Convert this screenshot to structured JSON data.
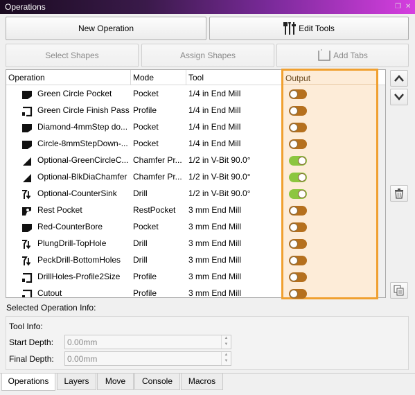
{
  "window": {
    "title": "Operations"
  },
  "toolbar": {
    "new_operation": "New Operation",
    "edit_tools": "Edit Tools",
    "select_shapes": "Select Shapes",
    "assign_shapes": "Assign Shapes",
    "add_tabs": "Add Tabs"
  },
  "table": {
    "headers": {
      "operation": "Operation",
      "mode": "Mode",
      "tool": "Tool",
      "output": "Output"
    },
    "rows": [
      {
        "name": "Green Circle Pocket",
        "mode": "Pocket",
        "tool": "1/4 in End Mill",
        "icon": "pocket-icon",
        "output": false
      },
      {
        "name": "Green Circle Finish Pass",
        "mode": "Profile",
        "tool": "1/4 in End Mill",
        "icon": "profile-icon",
        "output": false
      },
      {
        "name": "Diamond-4mmStep do...",
        "mode": "Pocket",
        "tool": "1/4 in End Mill",
        "icon": "pocket-icon",
        "output": false
      },
      {
        "name": "Circle-8mmStepDown-...",
        "mode": "Pocket",
        "tool": "1/4 in End Mill",
        "icon": "pocket-icon",
        "output": false
      },
      {
        "name": "Optional-GreenCircleC...",
        "mode": "Chamfer Pr...",
        "tool": "1/2 in V-Bit 90.0°",
        "icon": "chamfer-icon",
        "output": true
      },
      {
        "name": "Optional-BlkDiaChamfer",
        "mode": "Chamfer Pr...",
        "tool": "1/2 in V-Bit 90.0°",
        "icon": "chamfer-icon",
        "output": true
      },
      {
        "name": "Optional-CounterSink",
        "mode": "Drill",
        "tool": "1/2 in V-Bit 90.0°",
        "icon": "drill-icon",
        "output": true
      },
      {
        "name": "Rest Pocket",
        "mode": "RestPocket",
        "tool": "3 mm End Mill",
        "icon": "rest-pocket-icon",
        "output": false
      },
      {
        "name": "Red-CounterBore",
        "mode": "Pocket",
        "tool": "3 mm End Mill",
        "icon": "pocket-icon",
        "output": false
      },
      {
        "name": "PlungDrill-TopHole",
        "mode": "Drill",
        "tool": "3 mm End Mill",
        "icon": "drill-icon",
        "output": false
      },
      {
        "name": "PeckDrill-BottomHoles",
        "mode": "Drill",
        "tool": "3 mm End Mill",
        "icon": "drill-icon",
        "output": false
      },
      {
        "name": "DrillHoles-Profile2Size",
        "mode": "Profile",
        "tool": "3 mm End Mill",
        "icon": "profile-icon",
        "output": false
      },
      {
        "name": "Cutout",
        "mode": "Profile",
        "tool": "3 mm End Mill",
        "icon": "profile-icon",
        "output": false
      }
    ]
  },
  "info": {
    "selected_label": "Selected Operation Info:",
    "tool_info": "Tool Info:",
    "start_depth_label": "Start Depth:",
    "start_depth_value": "0.00mm",
    "final_depth_label": "Final Depth:",
    "final_depth_value": "0.00mm"
  },
  "tabs": [
    "Operations",
    "Layers",
    "Move",
    "Console",
    "Macros"
  ],
  "colors": {
    "output_off": "#b5701e",
    "output_on": "#8cc63f",
    "highlight_border": "#f0a030",
    "highlight_fill": "#fdecd8"
  }
}
